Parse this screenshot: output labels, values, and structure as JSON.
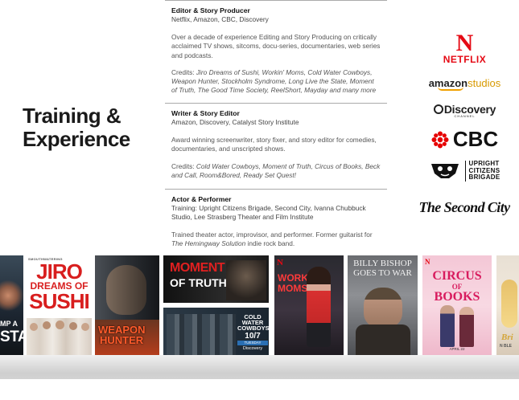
{
  "heading": {
    "line1": "Training &",
    "line2": "Experience"
  },
  "sections": [
    {
      "title": "Editor & Story Producer",
      "org": "Netflix, Amazon, CBC, Discovery",
      "desc": "Over a decade of experience Editing and Story Producing on critically acclaimed TV shows, sitcoms, docu-series, documentaries, web series and podcasts.",
      "credits_label": "Credits:",
      "credits": "Jiro Dreams of Sushi, Workin' Moms, Cold Water Cowboys, Weapon Hunter, Stockholm Syndrome, Long Live the State, Moment of Truth, The Good Time Society, ReelShort, Mayday and many more"
    },
    {
      "title": "Writer & Story Editor",
      "org": "Amazon, Discovery, Catalyst Story Institute",
      "desc": "Award winning screenwriter, story fixer, and story editor for comedies, documentaries, and unscripted shows.",
      "credits_label": "Credits:",
      "credits": "Cold Water Cowboys, Moment of Truth, Circus of Books, Beck and Call, Room&Bored, Ready Set Quest!"
    },
    {
      "title": "Actor & Performer",
      "org": "Training: Upright Citizens Brigade, Second City, Ivanna Chubbuck Studio, Lee Strasberg Theater and Film Institute",
      "desc_start": "Trained theater actor, improvisor, and performer. Former guitarist for",
      "desc_em": "The Hemingway Solution",
      "desc_end": "indie rock band."
    }
  ],
  "logos": {
    "netflix_n": "N",
    "netflix": "NETFLIX",
    "amazon_a": "amazon",
    "amazon_b": "studios",
    "discovery": "Discovery",
    "discovery_sub": "CHANNEL",
    "cbc": "CBC",
    "ucb": [
      "UPRIGHT",
      "CITIZENS",
      "BRIGADE"
    ],
    "second_city": "The Second City"
  },
  "posters": {
    "p0": {
      "line1": "MP A",
      "line2": "STAR"
    },
    "jiro": {
      "top": "SMOUTHWATERING",
      "line1": "JIRO",
      "line2": "DREAMS OF",
      "line3": "SUSHI"
    },
    "weapon": {
      "line1": "WEAPON",
      "line2": "HUNTER"
    },
    "moment": {
      "line1": "MOMENT",
      "line2": "OF TRUTH"
    },
    "cowboys": {
      "line1": "COLD",
      "line2": "WATER",
      "line3": "COWBOYS",
      "line4": "10/7",
      "line5": "TUESDAY",
      "line6": "Discovery"
    },
    "workin": {
      "n": "N",
      "line1": "WORKIN'",
      "line2": "MOMS"
    },
    "billy": {
      "line1": "BILLY BISHOP",
      "line2": "GOES TO WAR"
    },
    "circus": {
      "n": "N",
      "line1": "CIRCUS",
      "line2": "OF",
      "line3": "BOOKS",
      "date": "APRIL 22"
    },
    "last": {
      "text": "Bri",
      "sub": "N BLE"
    }
  },
  "colors": {
    "netflix": "#e50914",
    "amazon_smile": "#f0a000",
    "cbc": "#e60000"
  }
}
